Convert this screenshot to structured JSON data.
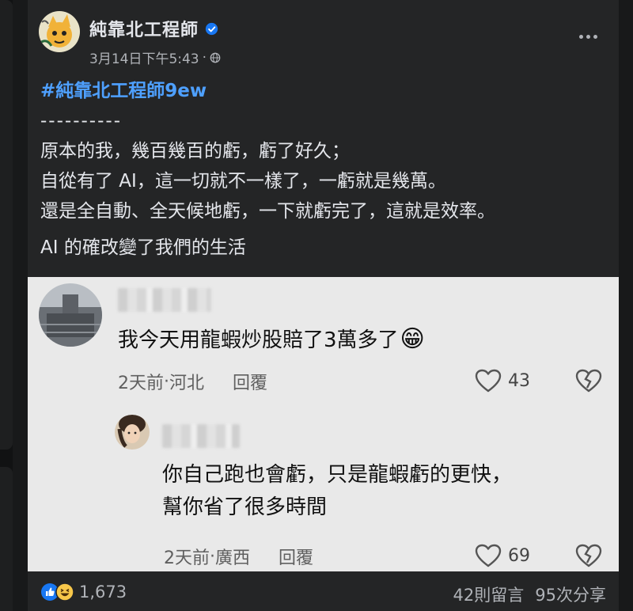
{
  "post": {
    "author": "純靠北工程師",
    "timestamp": "3月14日下午5:43",
    "separator": "·",
    "visibility_icon": "globe-icon",
    "hashtag": "#純靠北工程師9ew",
    "divider": "----------",
    "lines": [
      "原本的我，幾百幾百的虧，虧了好久；",
      "自從有了 AI，這一切就不一樣了，一虧就是幾萬。",
      "還是全自動、全天候地虧，一下就虧完了，這就是效率。"
    ],
    "closing": "AI 的確改變了我們的生活"
  },
  "comments": [
    {
      "text": "我今天用龍蝦炒股賠了3萬多了",
      "emoji": "😁",
      "time": "2天前",
      "sep": " · ",
      "location": "河北",
      "reply_label": "回覆",
      "likes": "43"
    },
    {
      "text_lines": [
        "你自己跑也會虧，只是龍蝦虧的更快，",
        "幫你省了很多時間"
      ],
      "time": "2天前",
      "sep": " · ",
      "location": "廣西",
      "reply_label": "回覆",
      "likes": "69"
    }
  ],
  "footer": {
    "reaction_count": "1,673",
    "comments_label": "42則留言",
    "shares_label": "95次分享"
  },
  "colors": {
    "background": "#18191a",
    "card": "#242526",
    "hashtag": "#4ea0ff",
    "comment_panel": "#e9e9e9",
    "like_blue": "#1877f2"
  }
}
